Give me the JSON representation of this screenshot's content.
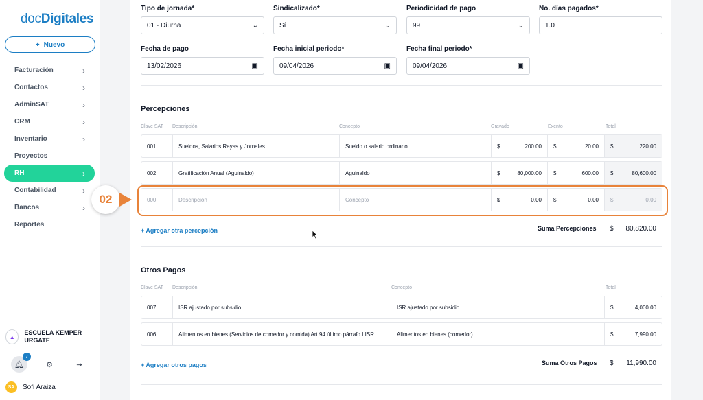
{
  "app": {
    "logo_prefix": "doc",
    "logo_suffix": "Digitales",
    "new_button": "Nuevo"
  },
  "sidebar": {
    "items": [
      {
        "label": "Facturación",
        "has_chevron": true,
        "active": false
      },
      {
        "label": "Contactos",
        "has_chevron": true,
        "active": false
      },
      {
        "label": "AdminSAT",
        "has_chevron": true,
        "active": false
      },
      {
        "label": "CRM",
        "has_chevron": true,
        "active": false
      },
      {
        "label": "Inventario",
        "has_chevron": true,
        "active": false
      },
      {
        "label": "Proyectos",
        "has_chevron": false,
        "active": false
      },
      {
        "label": "RH",
        "has_chevron": true,
        "active": true
      },
      {
        "label": "Contabilidad",
        "has_chevron": true,
        "active": false
      },
      {
        "label": "Bancos",
        "has_chevron": true,
        "active": false
      },
      {
        "label": "Reportes",
        "has_chevron": false,
        "active": false
      }
    ],
    "organization": "ESCUELA KEMPER URGATE",
    "notification_count": "7",
    "user_initials": "SA",
    "user_name": "Sofi Araiza"
  },
  "form": {
    "tipo_jornada": {
      "label": "Tipo de jornada*",
      "value": "01 - Diurna"
    },
    "sindicalizado": {
      "label": "Sindicalizado*",
      "value": "Sí"
    },
    "periodicidad": {
      "label": "Periodicidad de pago",
      "value": "99"
    },
    "dias_pagados": {
      "label": "No. días pagados*",
      "value": "1.0"
    },
    "fecha_pago": {
      "label": "Fecha de pago",
      "value": "13/02/2026"
    },
    "fecha_inicial": {
      "label": "Fecha inicial periodo*",
      "value": "09/04/2026"
    },
    "fecha_final": {
      "label": "Fecha final periodo*",
      "value": "09/04/2026"
    }
  },
  "percepciones": {
    "title": "Percepciones",
    "headers": {
      "clave": "Clave SAT",
      "descripcion": "Descripción",
      "concepto": "Concepto",
      "gravado": "Gravado",
      "exento": "Exento",
      "total": "Total"
    },
    "rows": [
      {
        "clave": "001",
        "descripcion": "Sueldos, Salarios Rayas y Jornales",
        "concepto": "Sueldo o salario ordinario",
        "gravado": "200.00",
        "exento": "20.00",
        "total": "220.00"
      },
      {
        "clave": "002",
        "descripcion": "Gratificación Anual (Aguinaldo)",
        "concepto": "Aguinaldo",
        "gravado": "80,000.00",
        "exento": "600.00",
        "total": "80,600.00"
      }
    ],
    "new_row": {
      "clave": "000",
      "descripcion": "Descripción",
      "concepto": "Concepto",
      "gravado": "0.00",
      "exento": "0.00",
      "total": "0.00"
    },
    "currency": "$",
    "add_link": "+ Agregar otra percepción",
    "sum_label": "Suma Percepciones",
    "sum_value": "80,820.00"
  },
  "otros_pagos": {
    "title": "Otros Pagos",
    "headers": {
      "clave": "Clave SAT",
      "descripcion": "Descripción",
      "concepto": "Concepto",
      "total": "Total"
    },
    "rows": [
      {
        "clave": "007",
        "descripcion": "ISR ajustado por subsidio.",
        "concepto": "ISR ajustado por subsidio",
        "total": "4,000.00"
      },
      {
        "clave": "006",
        "descripcion": "Alimentos en bienes (Servicios de comedor y comida) Art 94 último párrafo LISR.",
        "concepto": "Alimentos en bienes (comedor)",
        "total": "7,990.00"
      }
    ],
    "currency": "$",
    "add_link": "+ Agregar otros pagos",
    "sum_label": "Suma Otros Pagos",
    "sum_value": "11,990.00"
  },
  "annotation": {
    "step": "02",
    "color": "#e8833a"
  },
  "colors": {
    "brand": "#1c7ec4",
    "active": "#22d39a"
  }
}
